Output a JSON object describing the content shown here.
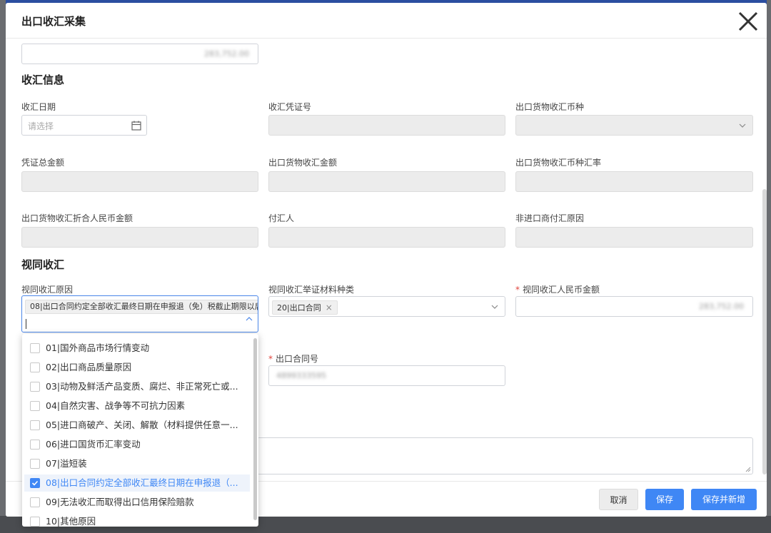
{
  "modal": {
    "title": "出口收汇采集"
  },
  "top_field": {
    "value": "283,752.00"
  },
  "sections": {
    "receipt_info": "收汇信息",
    "deemed_receipt": "视同收汇"
  },
  "fields": {
    "receipt_date": {
      "label": "收汇日期",
      "placeholder": "请选择"
    },
    "receipt_voucher_no": {
      "label": "收汇凭证号"
    },
    "export_currency": {
      "label": "出口货物收汇币种"
    },
    "voucher_total": {
      "label": "凭证总金额"
    },
    "export_receipt_amount": {
      "label": "出口货物收汇金额"
    },
    "export_currency_rate": {
      "label": "出口货物收汇币种汇率"
    },
    "export_rmb_amount": {
      "label": "出口货物收汇折合人民币金额"
    },
    "payer": {
      "label": "付汇人"
    },
    "non_importer_reason": {
      "label": "非进口商付汇原因"
    },
    "deemed_reason": {
      "label": "视同收汇原因",
      "selected_tag": "08|出口合同约定全部收汇最终日期在申报退（免）税截止期限以后"
    },
    "deemed_material_type": {
      "label": "视同收汇举证材料种类",
      "selected_tag": "20|出口合同"
    },
    "deemed_rmb_amount": {
      "label": "视同收汇人民币金额",
      "required": "*",
      "value": "283,752.00"
    },
    "export_contract_no": {
      "label": "出口合同号",
      "required": "*",
      "value": "4899333595"
    }
  },
  "dropdown": {
    "options": [
      {
        "label": "01|国外商品市场行情变动",
        "checked": false
      },
      {
        "label": "02|出口商品质量原因",
        "checked": false
      },
      {
        "label": "03|动物及鲜活产品变质、腐烂、非正常死亡或...",
        "checked": false
      },
      {
        "label": "04|自然灾害、战争等不可抗力因素",
        "checked": false
      },
      {
        "label": "05|进口商破产、关闭、解散（材料提供任意一...",
        "checked": false
      },
      {
        "label": "06|进口国货币汇率变动",
        "checked": false
      },
      {
        "label": "07|溢短装",
        "checked": false
      },
      {
        "label": "08|出口合同约定全部收汇最终日期在申报退（...",
        "checked": true
      },
      {
        "label": "09|无法收汇而取得出口信用保险赔款",
        "checked": false
      },
      {
        "label": "10|其他原因",
        "checked": false
      }
    ]
  },
  "footer": {
    "cancel": "取消",
    "save": "保存",
    "save_new": "保存并新增"
  },
  "colors": {
    "primary": "#3f87f5",
    "required": "#e0443c",
    "disabled_bg": "#ececec"
  },
  "icons": {
    "close": "close-icon",
    "calendar": "calendar-icon",
    "chevron": "chevron-down-icon",
    "check": "check-icon"
  }
}
